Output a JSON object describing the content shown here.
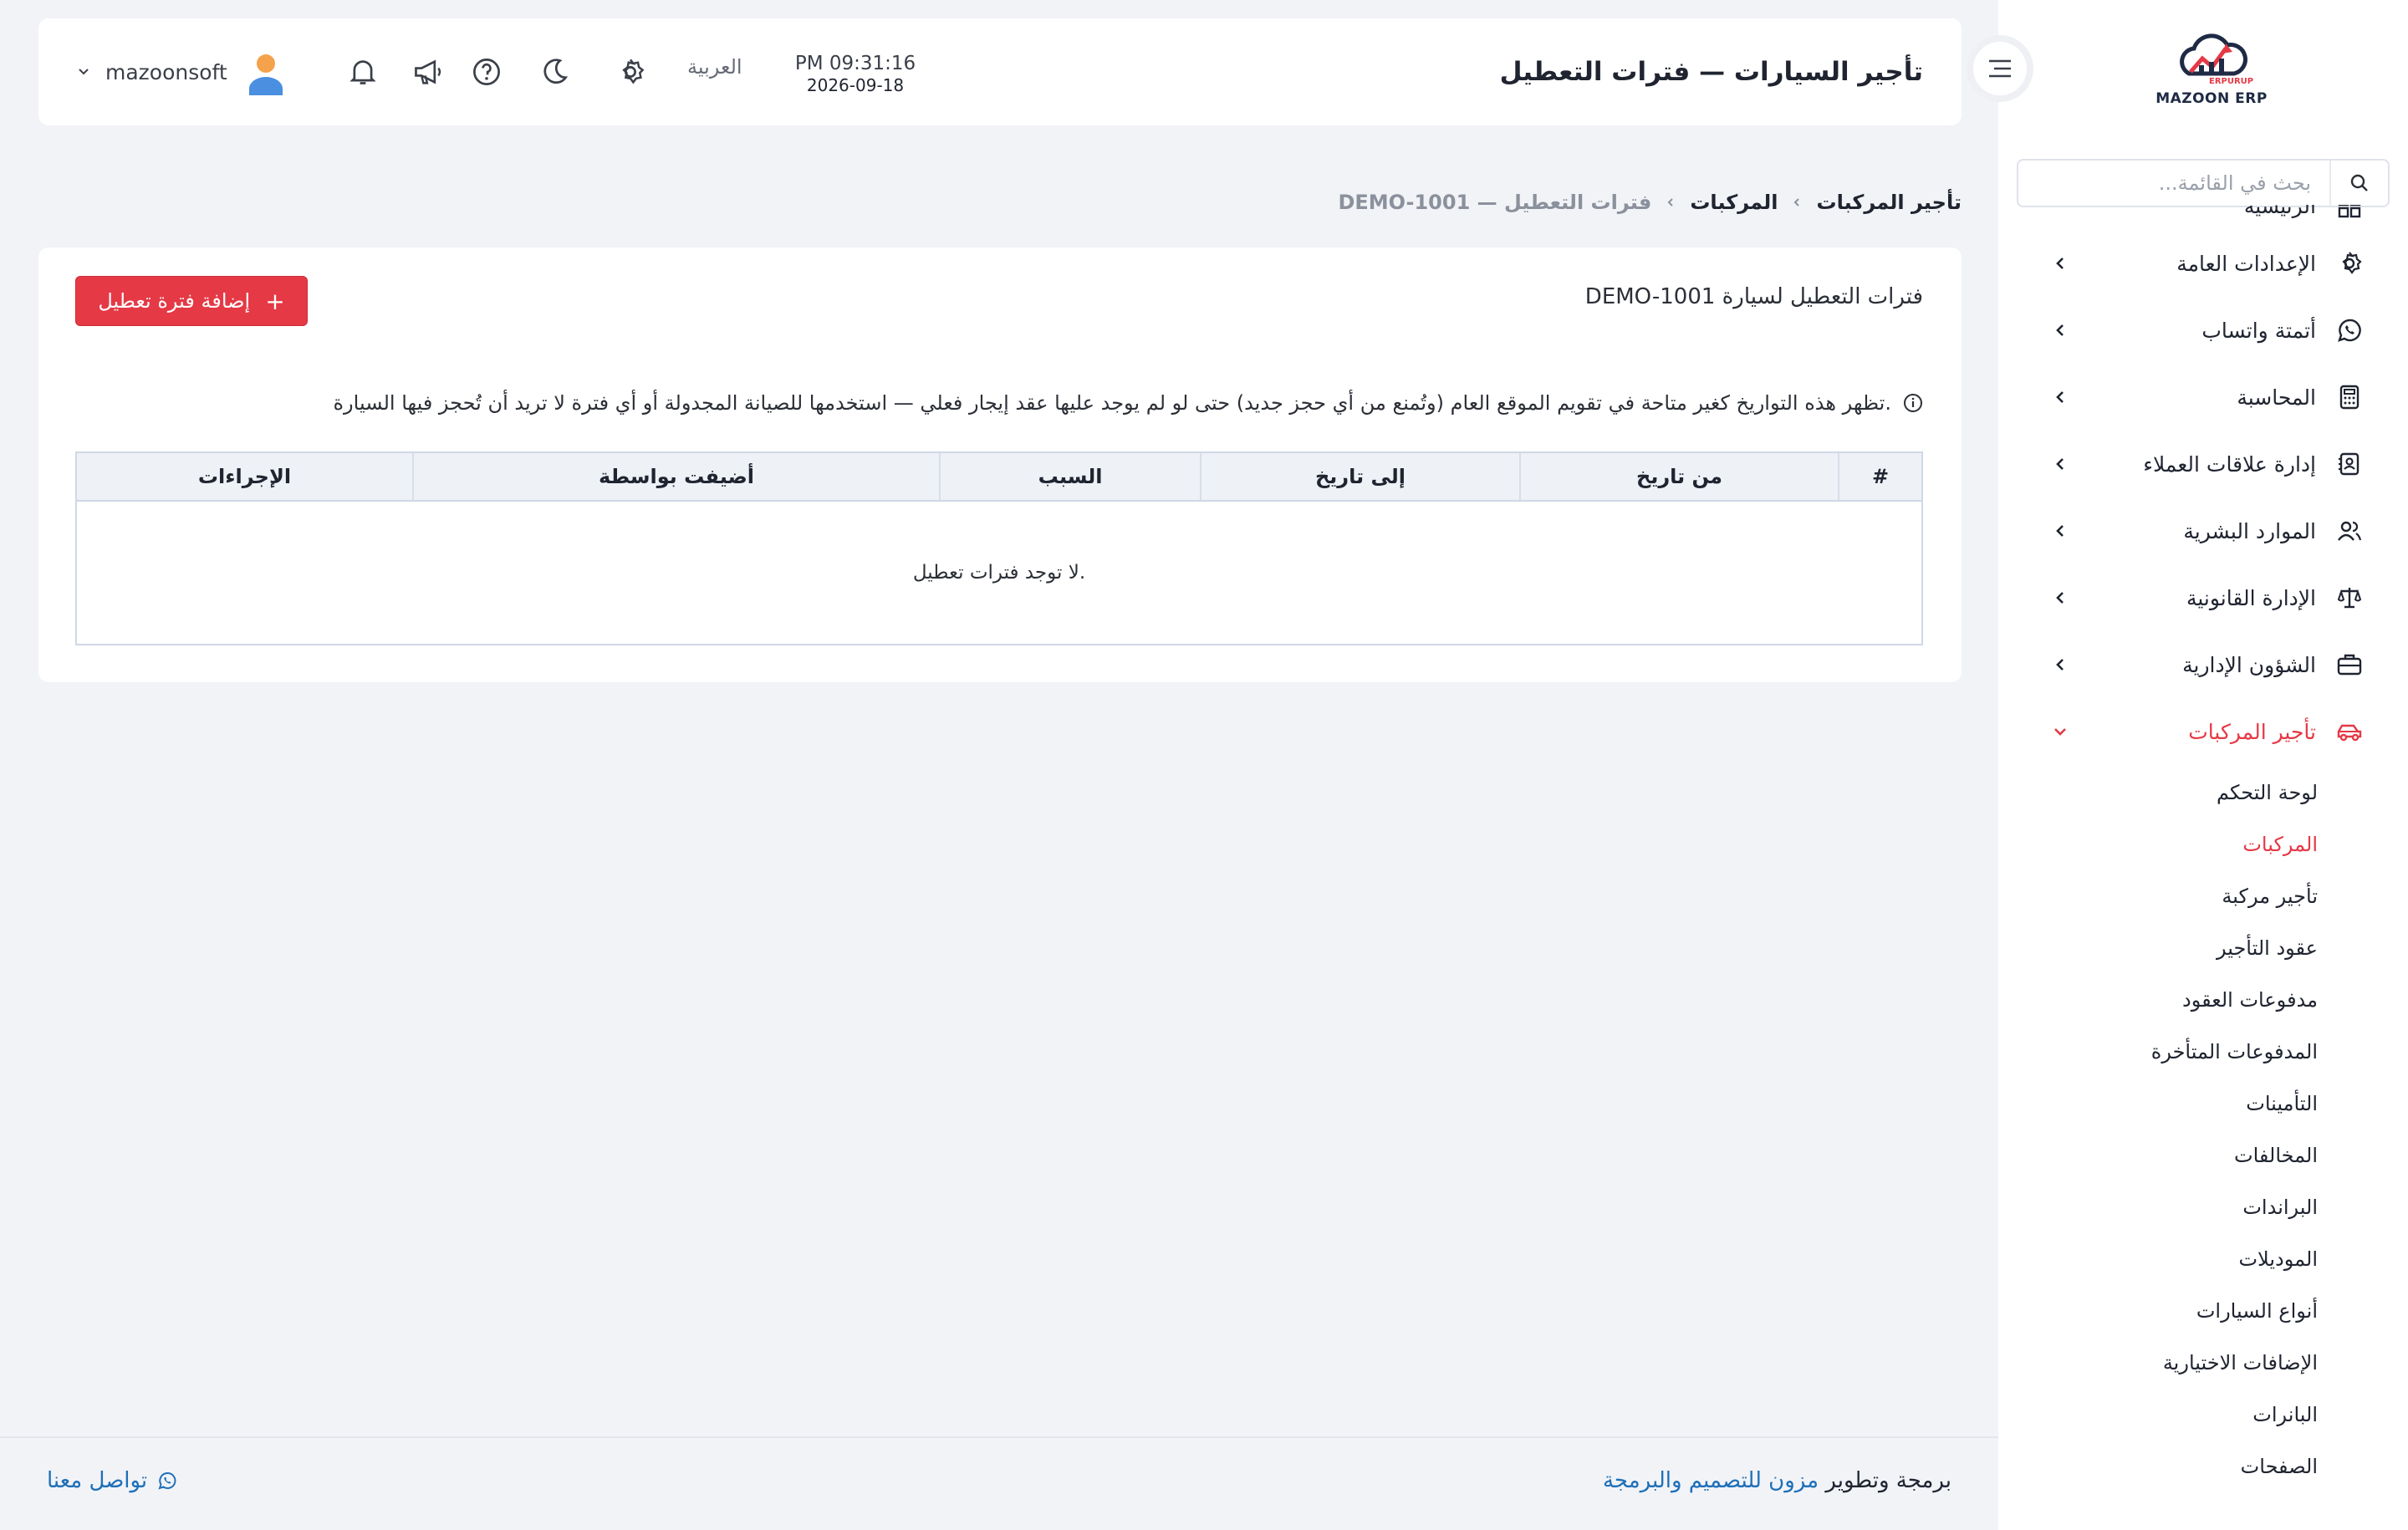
{
  "app": {
    "logo_text": "MAZOON ERP",
    "logo_sub": "ERPURUP"
  },
  "header": {
    "title": "تأجير السيارات — فترات التعطيل",
    "time": "PM 09:31:16",
    "date": "2026-09-18",
    "language": "العربية",
    "username": "mazoonsoft"
  },
  "sidebar": {
    "search_placeholder": "بحث في القائمة...",
    "partial_item": "الرئيسية",
    "items": [
      {
        "label": "الإعدادات العامة",
        "icon": "gear-icon"
      },
      {
        "label": "أتمتة واتساب",
        "icon": "whatsapp-icon"
      },
      {
        "label": "المحاسبة",
        "icon": "calculator-icon"
      },
      {
        "label": "إدارة علاقات العملاء",
        "icon": "contact-card-icon"
      },
      {
        "label": "الموارد البشرية",
        "icon": "users-icon"
      },
      {
        "label": "الإدارة القانونية",
        "icon": "scale-icon"
      },
      {
        "label": "الشؤون الإدارية",
        "icon": "briefcase-icon"
      },
      {
        "label": "تأجير المركبات",
        "icon": "car-icon"
      }
    ],
    "submenu": [
      "لوحة التحكم",
      "المركبات",
      "تأجير مركبة",
      "عقود التأجير",
      "مدفوعات العقود",
      "المدفوعات المتأخرة",
      "التأمينات",
      "المخالفات",
      "البراندات",
      "الموديلات",
      "أنواع السيارات",
      "الإضافات الاختيارية",
      "البانرات",
      "الصفحات"
    ],
    "active_submenu_index": 1
  },
  "breadcrumb": {
    "items": [
      "تأجير المركبات",
      "المركبات",
      "DEMO-1001 — فترات التعطيل"
    ]
  },
  "card": {
    "title": "فترات التعطيل لسيارة DEMO-1001",
    "add_button": "إضافة فترة تعطيل",
    "notice": "تظهر هذه التواريخ كغير متاحة في تقويم الموقع العام (وتُمنع من أي حجز جديد) حتى لو لم يوجد عليها عقد إيجار فعلي — استخدمها للصيانة المجدولة أو أي فترة لا تريد أن تُحجز فيها السيارة.",
    "table": {
      "columns": [
        "#",
        "من تاريخ",
        "إلى تاريخ",
        "السبب",
        "أضيفت بواسطة",
        "الإجراءات"
      ],
      "empty_text": "لا توجد فترات تعطيل."
    }
  },
  "footer": {
    "credit_prefix": "برمجة وتطوير",
    "credit_link": "مزون للتصميم والبرمجة",
    "contact": "تواصل معنا"
  },
  "colors": {
    "accent": "#e53945",
    "link": "#1e6fb8",
    "background": "#f1f3f7"
  }
}
